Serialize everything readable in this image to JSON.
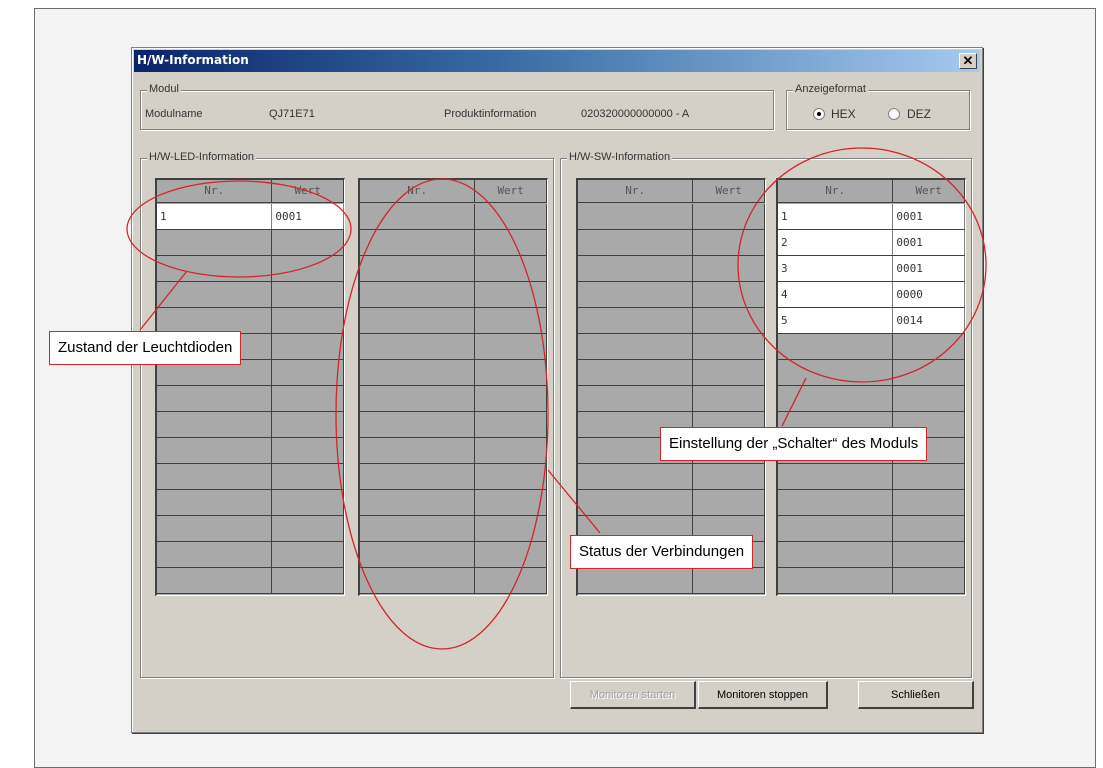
{
  "window": {
    "title": "H/W-Information",
    "close_symbol": "✕"
  },
  "modul": {
    "group_label": "Modul",
    "name_label": "Modulname",
    "name_value": "QJ71E71",
    "product_label": "Produktinformation",
    "product_value": "020320000000000 - A"
  },
  "anzeigeformat": {
    "group_label": "Anzeigeformat",
    "options": [
      {
        "label": "HEX",
        "selected": true
      },
      {
        "label": "DEZ",
        "selected": false
      }
    ]
  },
  "led_info": {
    "group_label": "H/W-LED-Information",
    "table1": {
      "headers": [
        "Nr.",
        "Wert"
      ],
      "rows": [
        {
          "nr": "1",
          "wert": "0001"
        }
      ]
    },
    "table2": {
      "headers": [
        "Nr.",
        "Wert"
      ],
      "rows": []
    }
  },
  "sw_info": {
    "group_label": "H/W-SW-Information",
    "table1": {
      "headers": [
        "Nr.",
        "Wert"
      ],
      "rows": []
    },
    "table2": {
      "headers": [
        "Nr.",
        "Wert"
      ],
      "rows": [
        {
          "nr": "1",
          "wert": "0001"
        },
        {
          "nr": "2",
          "wert": "0001"
        },
        {
          "nr": "3",
          "wert": "0001"
        },
        {
          "nr": "4",
          "wert": "0000"
        },
        {
          "nr": "5",
          "wert": "0014"
        }
      ]
    }
  },
  "buttons": {
    "monitor_start": "Monitoren starten",
    "monitor_stop": "Monitoren stoppen",
    "close": "Schließen"
  },
  "annotations": {
    "led_state": "Zustand der Leuchtdioden",
    "switch_settings": "Einstellung der „Schalter“ des Moduls",
    "connection_status": "Status der Verbindungen",
    "color": "#d0262a"
  }
}
